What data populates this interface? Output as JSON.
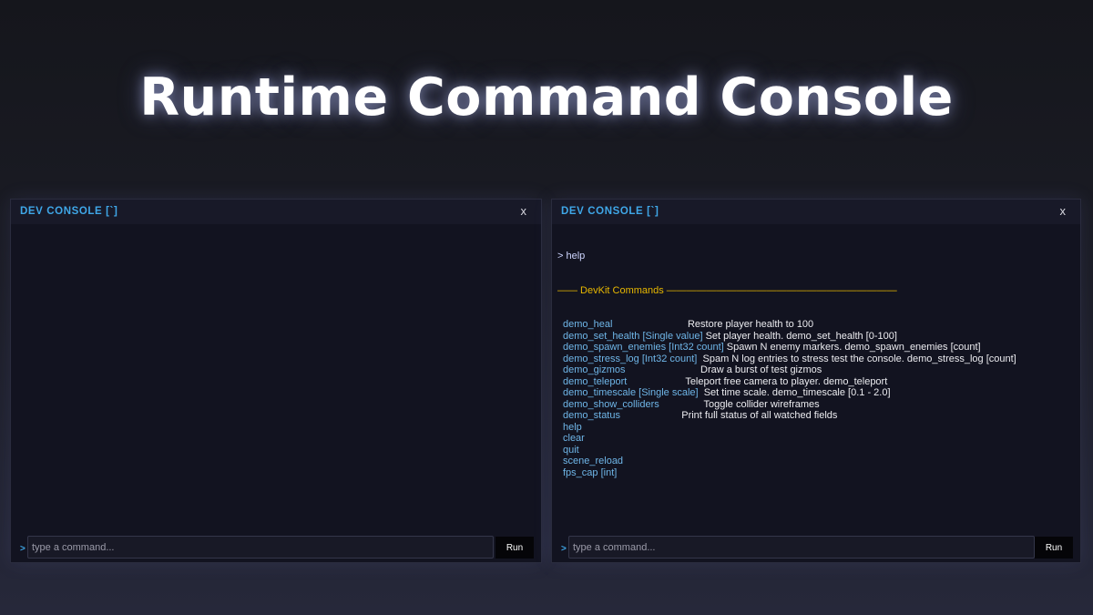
{
  "page": {
    "title": "Runtime Command Console"
  },
  "consoles": [
    {
      "title": "DEV CONSOLE [`]",
      "close_label": "x",
      "prompt": ">",
      "input_placeholder": "type a command...",
      "input_value": "",
      "run_label": "Run",
      "log": []
    },
    {
      "title": "DEV CONSOLE [`]",
      "close_label": "x",
      "prompt": ">",
      "input_placeholder": "type a command...",
      "input_value": "",
      "run_label": "Run",
      "log": {
        "echo": "> help",
        "separator": "—— DevKit Commands ———————————————————————",
        "commands": [
          {
            "name": "demo_heal",
            "gap": "                           ",
            "desc": "Restore player health to 100"
          },
          {
            "name": "demo_set_health [Single value]",
            "gap": " ",
            "desc": "Set player health. demo_set_health [0-100]"
          },
          {
            "name": "demo_spawn_enemies [Int32 count]",
            "gap": " ",
            "desc": "Spawn N enemy markers. demo_spawn_enemies [count]"
          },
          {
            "name": "demo_stress_log [Int32 count]",
            "gap": "  ",
            "desc": "Spam N log entries to stress test the console. demo_stress_log [count]"
          },
          {
            "name": "demo_gizmos",
            "gap": "                           ",
            "desc": "Draw a burst of test gizmos"
          },
          {
            "name": "demo_teleport",
            "gap": "                     ",
            "desc": "Teleport free camera to player. demo_teleport"
          },
          {
            "name": "demo_timescale [Single scale]",
            "gap": "  ",
            "desc": "Set time scale. demo_timescale [0.1 - 2.0]"
          },
          {
            "name": "demo_show_colliders",
            "gap": "                ",
            "desc": "Toggle collider wireframes"
          },
          {
            "name": "demo_status",
            "gap": "                      ",
            "desc": "Print full status of all watched fields"
          },
          {
            "name": "help",
            "gap": "",
            "desc": ""
          },
          {
            "name": "clear",
            "gap": "",
            "desc": ""
          },
          {
            "name": "quit",
            "gap": "",
            "desc": ""
          },
          {
            "name": "scene_reload",
            "gap": "",
            "desc": ""
          },
          {
            "name": "fps_cap [int]",
            "gap": "",
            "desc": ""
          }
        ]
      }
    }
  ],
  "colors": {
    "accent": "#3fa7e8",
    "separator": "#e8b800",
    "command_name": "#6fb6e8",
    "panel_bg": "#121320"
  }
}
